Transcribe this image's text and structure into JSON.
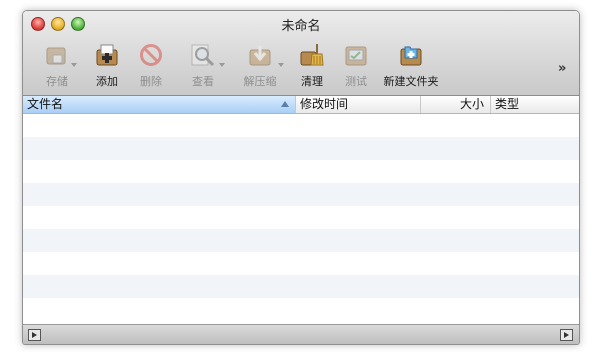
{
  "window": {
    "title": "未命名"
  },
  "toolbar": {
    "items": [
      {
        "label": "存储",
        "icon": "archive-store-icon",
        "enabled": false,
        "menu": true
      },
      {
        "label": "添加",
        "icon": "add-box-icon",
        "enabled": true,
        "menu": false
      },
      {
        "label": "删除",
        "icon": "delete-no-icon",
        "enabled": false,
        "menu": false
      },
      {
        "label": "查看",
        "icon": "magnifier-icon",
        "enabled": false,
        "menu": true
      },
      {
        "label": "解压缩",
        "icon": "extract-box-icon",
        "enabled": false,
        "menu": true
      },
      {
        "label": "清理",
        "icon": "broom-box-icon",
        "enabled": true,
        "menu": false
      },
      {
        "label": "测试",
        "icon": "test-monitor-icon",
        "enabled": false,
        "menu": false
      },
      {
        "label": "新建文件夹",
        "icon": "new-folder-icon",
        "enabled": true,
        "menu": false
      }
    ],
    "overflow_glyph": "»"
  },
  "table": {
    "columns": [
      "文件名",
      "修改时间",
      "大小",
      "类型"
    ],
    "sorted_column": "文件名",
    "sort_direction": "ascending"
  },
  "colors": {
    "row_stripe": "#f1f5fa",
    "sorted_header": "#a9cff5"
  }
}
